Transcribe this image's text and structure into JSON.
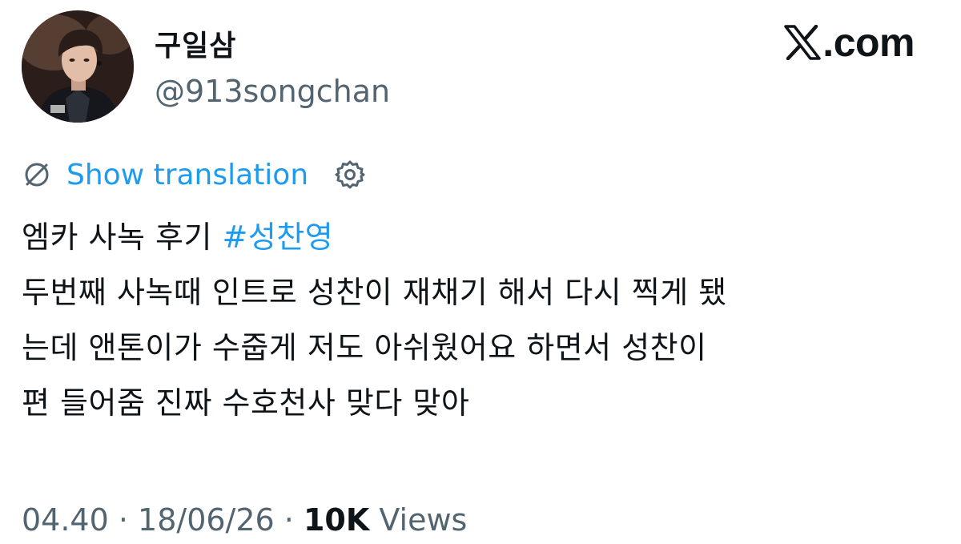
{
  "author": {
    "display_name": "구일삼",
    "handle": "@913songchan",
    "avatar": "profile-photo"
  },
  "brand": {
    "label": ".com",
    "icon": "x-logo-icon"
  },
  "translation": {
    "link_label": "Show translation",
    "icon": "translate-icon",
    "settings_icon": "gear-icon"
  },
  "tweet": {
    "line1_text": "엠카 사녹 후기 ",
    "hashtag": "#성찬영",
    "line2": "두번째 사녹때 인트로 성찬이 재채기 해서 다시 찍게 됐",
    "line3": "는데 앤톤이가 수줍게 저도 아쉬웠어요 하면서 성찬이",
    "line4": "편 들어줌 진짜 수호천사 맞다 맞아"
  },
  "meta": {
    "time": "04.40",
    "separator1": " · ",
    "date": "18/06/26",
    "separator2": " · ",
    "views_count": "10K",
    "views_label": " Views"
  },
  "colors": {
    "accent": "#1d9bf0",
    "text_primary": "#0f1419",
    "text_secondary": "#536471"
  }
}
